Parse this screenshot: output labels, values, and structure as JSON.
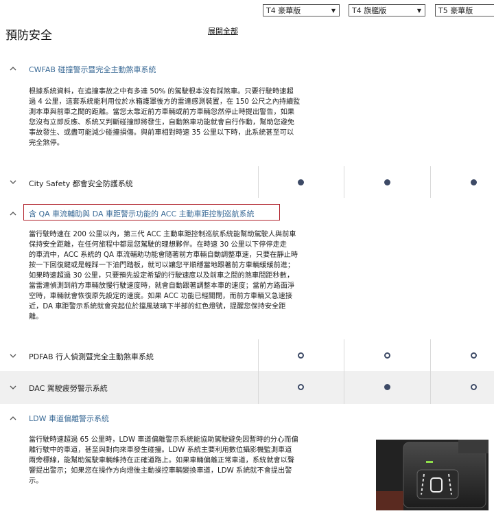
{
  "versions": [
    {
      "label": "T4 豪華版"
    },
    {
      "label": "T4 旗艦版"
    },
    {
      "label": "T5 豪華版"
    }
  ],
  "page": {
    "title": "預防安全",
    "expand_all": "展開全部"
  },
  "sections": {
    "cwfab": {
      "title": "CWFAB 碰撞警示暨完全主動煞車系統",
      "desc": [
        "根據系統資料，在追撞事故之中有多達 50% 的駕駛根本沒有踩煞車。只要行駛時速超",
        "過 4 公里，這套系統能利用位於水箱護罩後方的雷達感測裝置，在 150 公尺之內持續監",
        "測本車與前車之間的距離。當您太靠近前方車輛或前方車輛忽然停止時提出警告，如果",
        "您沒有立即反應、系統又判斷碰撞即將發生，自動煞車功能就會自行作動，幫助您避免",
        "事故發生、或盡可能減少碰撞損傷。與前車相對時速 35 公里以下時，此系統甚至可以",
        "完全煞停。"
      ]
    },
    "city_safety": {
      "title": "City Safety 都會安全防護系統",
      "availability": [
        "filled",
        "filled",
        "filled"
      ]
    },
    "acc": {
      "title": "含 QA 車流輔助與 DA 車距警示功能的 ACC 主動車距控制巡航系統",
      "desc": [
        "當行駛時速在 200 公里以內，第三代 ACC 主動車距控制巡航系統能幫助駕駛人與前車",
        "保持安全距離，在任何旅程中都是您駕駛的理想夥伴。在時速 30 公里以下停停走走",
        "的車流中，ACC 系統的 QA 車流輔助功能會隨著前方車輛自動調整車速，只要在靜止時",
        "按一下回復鍵或是輕踩一下油門踏板，就可以讓您平順穩當地跟著前方車輛緩緩前進；",
        "如果時速超過 30 公里，只要預先設定希望的行駛速度以及前車之間的煞車間距秒數，",
        "當雷達偵測到前方車輛放慢行駛速度時，就會自動跟著調整本車的速度；當前方路面淨",
        "空時，車輛就會恢復原先設定的速度。如果 ACC 功能已經關閉，而前方車輛又急速接",
        "近，DA 車距警示系統就會亮起位於擋風玻璃下半部的紅色燈號，提醒您保持安全距",
        "離。"
      ]
    },
    "pdfab": {
      "title": "PDFAB 行人偵測暨完全主動煞車系統",
      "availability": [
        "hollow",
        "hollow",
        "hollow"
      ]
    },
    "dac": {
      "title": "DAC 駕駛疲勞警示系統",
      "availability": [
        "hollow",
        "filled",
        "hollow"
      ]
    },
    "ldw": {
      "title": "LDW 車道偏離警示系統",
      "desc": [
        "當行駛時速超過 65 公里時，LDW 車道偏離警示系統能協助駕駛避免因暫時的分心而偏",
        "離行駛中的車道，甚至與對向來車發生碰撞。LDW 系統主要利用數位攝影機監測車道",
        "兩旁標線，能幫助駕駛車輛維持在正確道路上。如果車輛偏離正常車道，系統就會以聲",
        "響提出警示；如果您在操作方向燈後主動操控車輛變換車道，LDW 系統就不會提出警",
        "示。"
      ]
    }
  },
  "icons": {
    "chevron_up": "^",
    "chevron_down": "v",
    "dropdown": "▼"
  },
  "colors": {
    "accent_blue": "#3a6a96",
    "dot": "#3d4a66",
    "highlight_border": "#b0202a"
  }
}
